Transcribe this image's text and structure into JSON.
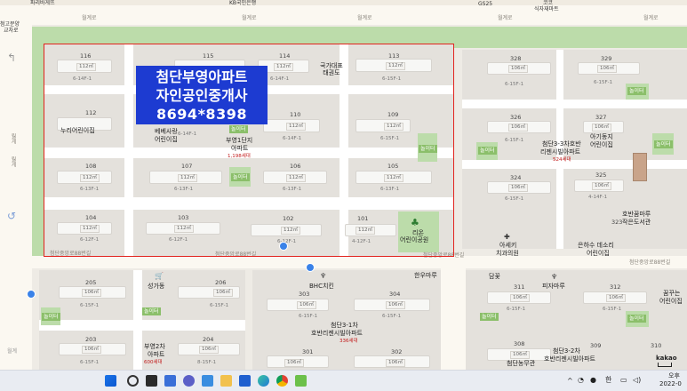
{
  "overlay": {
    "line1": "첨단부영아파트",
    "line2": "자인공인중개사",
    "line3": "8694*8398",
    "bg": "#1d3bd1"
  },
  "top": {
    "left_label": "파리바게뜨",
    "kb_label": "KB국민은행",
    "gs_label": "GS25",
    "coco_line1": "코코",
    "coco_line2": "식자재마트",
    "road_labels": [
      "월계로",
      "월계로",
      "월계로",
      "월계로",
      "월계로"
    ]
  },
  "left": {
    "crossroad_line1": "첨고분양",
    "crossroad_line2": "교차로",
    "vert_label1": "월계",
    "vert_label2": "월계"
  },
  "roads": {
    "bottom_main": "첨단중앙로88번길",
    "bottom_mid": "첨단중앙로88번길",
    "bottom_right": "첨단중앙로88번길",
    "right_mid": "첨단중앙로88번길"
  },
  "buildings": [
    {
      "num": "116",
      "area": "112㎡",
      "floor": "6-14F-1"
    },
    {
      "num": "115",
      "area": "112㎡",
      "floor": "6-14F-1"
    },
    {
      "num": "114",
      "area": "112㎡",
      "floor": "6-14F-1"
    },
    {
      "num": "113",
      "area": "112㎡",
      "floor": "6-15F-1"
    },
    {
      "num": "112",
      "area": "",
      "floor": ""
    },
    {
      "num": "110",
      "area": "112㎡",
      "floor": "6-14F-1"
    },
    {
      "num": "109",
      "area": "112㎡",
      "floor": "6-15F-1"
    },
    {
      "num": "108",
      "area": "112㎡",
      "floor": "6-13F-1"
    },
    {
      "num": "107",
      "area": "112㎡",
      "floor": "6-13F-1"
    },
    {
      "num": "106",
      "area": "112㎡",
      "floor": "6-13F-1"
    },
    {
      "num": "105",
      "area": "112㎡",
      "floor": "6-13F-1"
    },
    {
      "num": "104",
      "area": "112㎡",
      "floor": "6-12F-1"
    },
    {
      "num": "103",
      "area": "112㎡",
      "floor": "6-12F-1"
    },
    {
      "num": "102",
      "area": "112㎡",
      "floor": "6-12F-1"
    },
    {
      "num": "101",
      "area": "112㎡",
      "floor": "4-12F-1"
    }
  ],
  "pois": {
    "gukga": "국가대표\n태권도",
    "nuri": "누리어린이집",
    "bebe_line1": "베베사랑",
    "bebe_line2": "어린이집",
    "pub_line1": "부영1단지",
    "pub_line2": "아파트",
    "pub_units": "1,198세대",
    "rion_line1": "리온",
    "rion_line2": "어린이공원",
    "hanwoo": "한우마루",
    "bhc": "BHC치킨",
    "seongga": "성가동",
    "dalkkok": "담꽃",
    "pizza": "피자마루",
    "aseki_line1": "아세키",
    "aseki_line2": "치과의원",
    "hobangu_line1": "호반꿈마루",
    "hobangu_line2": "작은도서관",
    "eunhasu_line1": "은하수 데소리",
    "eunhasu_line2": "어린이집",
    "kkum_line1": "꿈꾸는",
    "kkum_line2": "어린이집",
    "cheomdan3_line1": "첨단3-3차호반",
    "cheomdan3_line2": "리젠시빌아파트",
    "cheomdan3_units": "524세대",
    "aitopia_line1": "아기동지",
    "aitopia_line2": "어린이집",
    "hoban3_1_line1": "첨단3-1차",
    "hoban3_1_line2": "호반리젠시빌아파트",
    "hoban3_1_units": "336세대",
    "hoban3_2_line1": "첨단3-2차",
    "hoban3_2_line2": "호반리젠시빌아파트",
    "buyoung2_line1": "부영2차",
    "buyoung2_line2": "아파트",
    "buyoung2_units": "600세대",
    "cheomdan_nong": "첨단농무관"
  },
  "green_badge": "놀이터",
  "right_blocks": [
    {
      "num": "328",
      "area": "106㎡",
      "floor": "6-15F-1"
    },
    {
      "num": "329",
      "area": "106㎡",
      "floor": "6-15F-1"
    },
    {
      "num": "326",
      "area": "106㎡",
      "floor": "6-15F-1"
    },
    {
      "num": "327",
      "area": "106㎡",
      "floor": ""
    },
    {
      "num": "324",
      "area": "106㎡",
      "floor": "6-15F-1"
    },
    {
      "num": "325",
      "area": "106㎡",
      "floor": "4-14F-1"
    },
    {
      "num": "323",
      "area": "",
      "floor": ""
    },
    {
      "num": "311",
      "area": "106㎡",
      "floor": "6-15F-1"
    },
    {
      "num": "312",
      "area": "106㎡",
      "floor": "6-15F-1"
    },
    {
      "num": "308",
      "area": "106㎡",
      "floor": ""
    },
    {
      "num": "309",
      "area": "",
      "floor": ""
    },
    {
      "num": "310",
      "area": "",
      "floor": ""
    }
  ],
  "lower_blocks": [
    {
      "num": "205",
      "area": "106㎡",
      "floor": "6-15F-1"
    },
    {
      "num": "206",
      "area": "106㎡",
      "floor": "6-15F-1"
    },
    {
      "num": "303",
      "area": "106㎡",
      "floor": "6-15F-1"
    },
    {
      "num": "304",
      "area": "106㎡",
      "floor": "6-15F-1"
    },
    {
      "num": "203",
      "area": "106㎡",
      "floor": "6-15F-1"
    },
    {
      "num": "204",
      "area": "106㎡",
      "floor": "8-15F-1"
    },
    {
      "num": "301",
      "area": "106㎡",
      "floor": ""
    },
    {
      "num": "302",
      "area": "106㎡",
      "floor": ""
    }
  ],
  "scale": "kakao",
  "taskbar": {
    "tray_lang": "한",
    "clock_line1": "오후",
    "clock_line2": "2022-0"
  }
}
